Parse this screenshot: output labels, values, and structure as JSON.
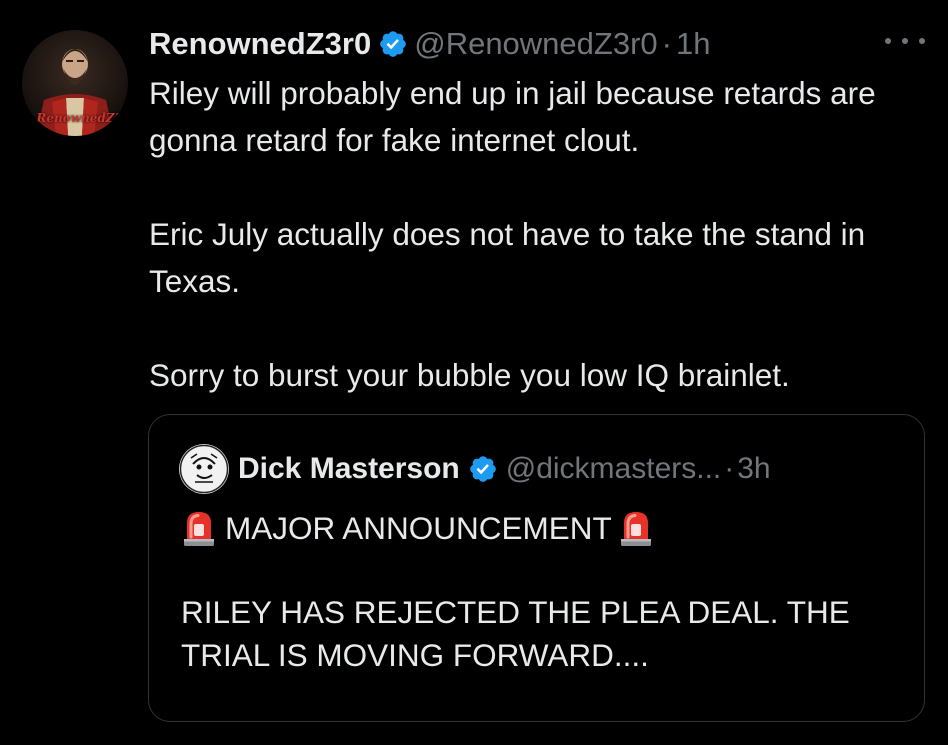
{
  "tweet": {
    "display_name": "RenownedZ3r0",
    "handle": "@RenownedZ3r0",
    "separator": "·",
    "time": "1h",
    "avatar_caption": "RenownedZ3r0",
    "paragraphs": [
      "Riley will probably end up in jail because retards are gonna retard for fake internet clout.",
      "Eric July actually does not have to take the stand in Texas.",
      "Sorry to burst your bubble you low IQ brainlet."
    ],
    "more_icon": "more-horizontal-icon",
    "verified_icon": "verified-badge-icon"
  },
  "quote": {
    "display_name": "Dick Masterson",
    "handle": "@dickmasters...",
    "separator": "·",
    "time": "3h",
    "announcement": "MAJOR ANNOUNCEMENT",
    "announcement_icon": "police-siren-icon",
    "body": "RILEY HAS REJECTED THE PLEA DEAL. THE TRIAL IS MOVING FORWARD...."
  },
  "colors": {
    "background": "#000000",
    "text_primary": "#e7e9ea",
    "text_secondary": "#71767b",
    "verified_blue": "#1d9bf0",
    "border": "#2f3336",
    "siren_red": "#e5332a"
  }
}
